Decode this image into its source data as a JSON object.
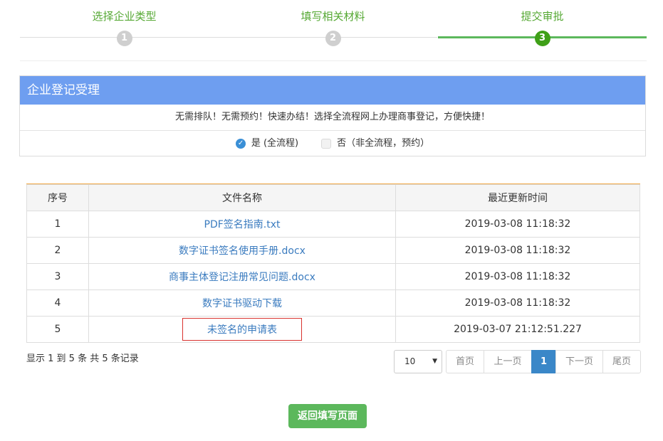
{
  "steps": [
    {
      "label": "选择企业类型",
      "number": "1",
      "active": false
    },
    {
      "label": "填写相关材料",
      "number": "2",
      "active": false
    },
    {
      "label": "提交审批",
      "number": "3",
      "active": true
    }
  ],
  "panel": {
    "title": "企业登记受理",
    "notice": "无需排队！无需预约！快速办结！选择全流程网上办理商事登记，方便快捷！",
    "options": [
      {
        "label": "是 (全流程)",
        "checked": true
      },
      {
        "label": "否（非全流程，预约）",
        "checked": false
      }
    ]
  },
  "table": {
    "headers": [
      "序号",
      "文件名称",
      "最近更新时间"
    ],
    "rows": [
      {
        "index": "1",
        "name": "PDF签名指南.txt",
        "time": "2019-03-08 11:18:32"
      },
      {
        "index": "2",
        "name": "数字证书签名使用手册.docx",
        "time": "2019-03-08 11:18:32"
      },
      {
        "index": "3",
        "name": "商事主体登记注册常见问题.docx",
        "time": "2019-03-08 11:18:32"
      },
      {
        "index": "4",
        "name": "数字证书驱动下载",
        "time": "2019-03-08 11:18:32"
      },
      {
        "index": "5",
        "name": "未签名的申请表",
        "time": "2019-03-07 21:12:51.227"
      }
    ]
  },
  "summary": "显示 1 到 5 条 共 5 条记录",
  "page_size": "10",
  "pagination": {
    "first": "首页",
    "prev": "上一页",
    "current": "1",
    "next": "下一页",
    "last": "尾页"
  },
  "back_button": "返回填写页面",
  "colors": {
    "accent_green": "#5cb85c",
    "panel_blue": "#6e9ef0",
    "link_blue": "#3a7bbf",
    "pager_active": "#3a87c8",
    "highlight_red": "#d9322e"
  }
}
